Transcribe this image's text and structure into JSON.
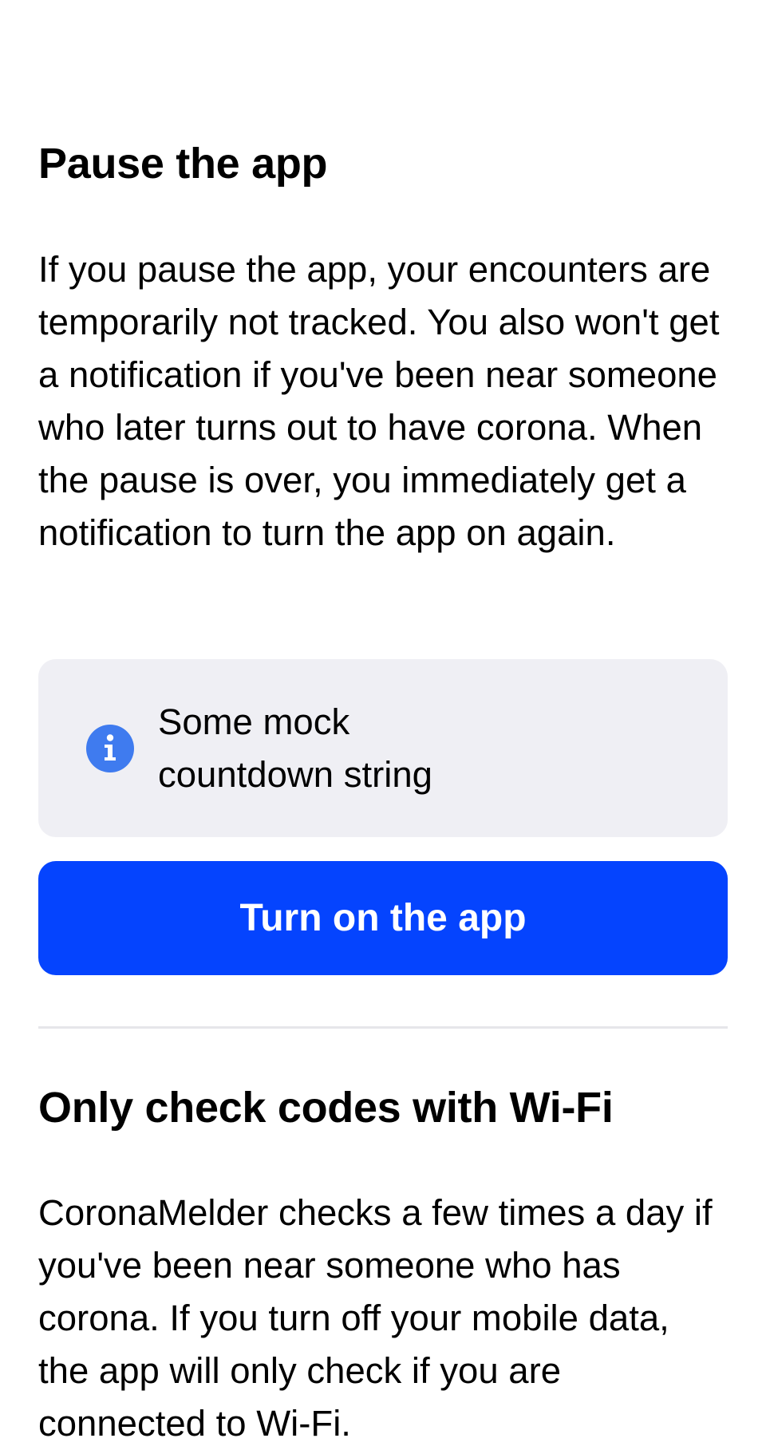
{
  "pause_section": {
    "title": "Pause the app",
    "description": "If you pause the app, your encounters are temporarily not tracked. You also won't get a notification if you've been near someone who later turns out to have corona. When the pause is over, you immediately get a notification to turn the app on again.",
    "info_box": {
      "icon": "info-icon",
      "text": "Some mock countdown string"
    },
    "button_label": "Turn on the app"
  },
  "wifi_section": {
    "title": "Only check codes with Wi-Fi",
    "description": "CoronaMelder checks a few times a day if you've been near someone who has corona. If you turn off your mobile data, the app will only check if you are connected to Wi-Fi."
  },
  "colors": {
    "accent": "#0544fe",
    "info_icon": "#3f7bef",
    "info_box_background": "#efeff4",
    "divider": "#e6e6ea"
  }
}
